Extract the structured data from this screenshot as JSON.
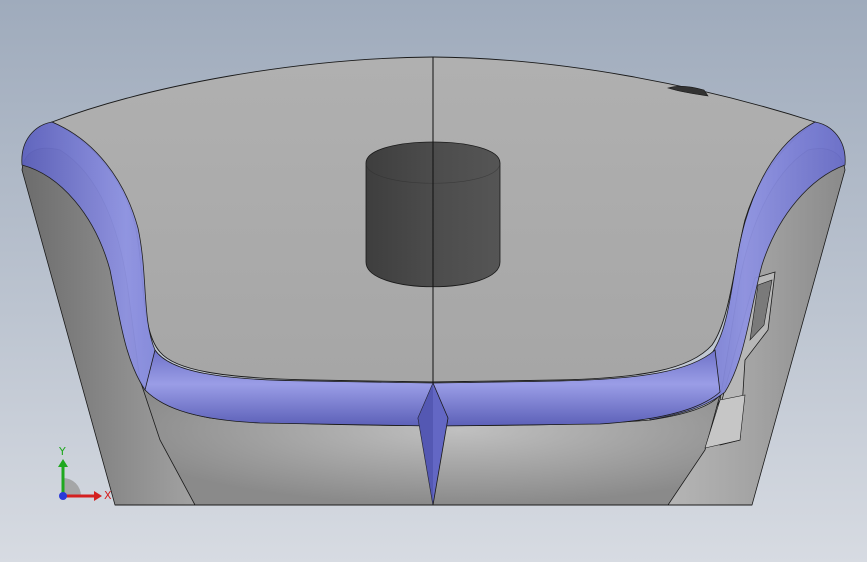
{
  "viewport": {
    "background_top": "#9fabbc",
    "background_bottom": "#d7dbe2"
  },
  "model": {
    "face_color": "#a9a9a9",
    "side_color": "#8a8a8a",
    "hole_color": "#4a4a4a",
    "highlight_color": "#7f83d8",
    "edge_color": "#1a1a1a"
  },
  "triad": {
    "x_label": "X",
    "y_label": "Y",
    "x_color": "#d42020",
    "y_color": "#1fa81f",
    "z_color": "#2a3ad8"
  }
}
